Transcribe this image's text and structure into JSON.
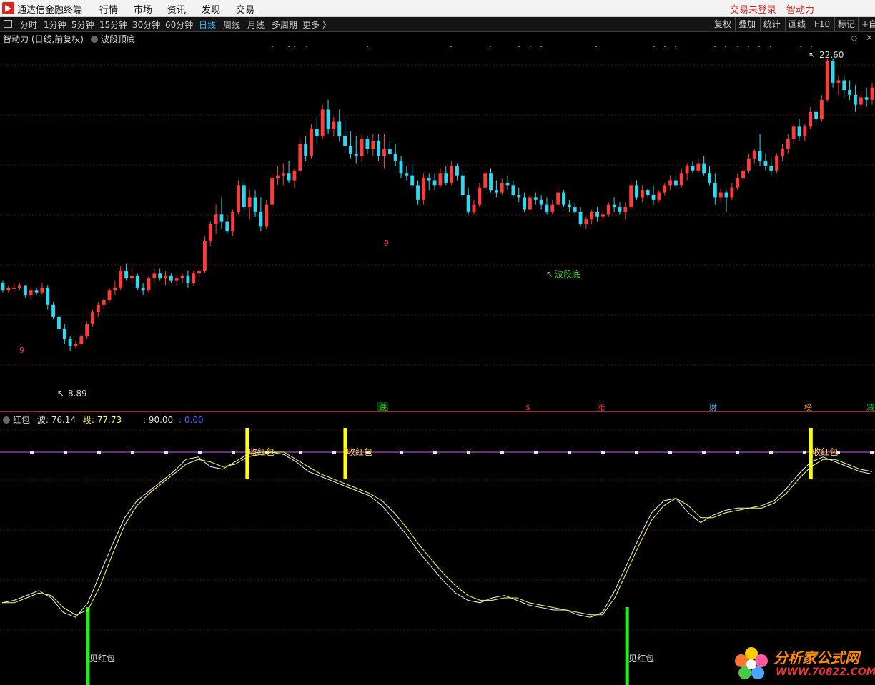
{
  "app": {
    "title": "通达信金融终端"
  },
  "menu": {
    "items": [
      "行情",
      "市场",
      "资讯",
      "发现",
      "交易"
    ],
    "login": "交易未登录",
    "brand": "智动力"
  },
  "toolbar": {
    "periods": [
      "分时",
      "1分钟",
      "5分钟",
      "15分钟",
      "30分钟",
      "60分钟",
      "日线",
      "周线",
      "月线",
      "多周期",
      "更多 〉"
    ],
    "active": "日线",
    "right": [
      "复权",
      "叠加",
      "统计",
      "画线",
      "F10",
      "标记",
      "+自"
    ]
  },
  "main_panel": {
    "title": "智动力 (日线,前复权)",
    "indicator": "波段顶底",
    "high_label": "22.60",
    "low_label": "8.89",
    "bottom_mark": "波段底",
    "count_marks": [
      "9",
      "9"
    ],
    "signal_marks": [
      {
        "label": "跌",
        "color": "#22c522"
      },
      {
        "label": "$",
        "color": "#e33"
      },
      {
        "label": "涨",
        "color": "#e33"
      },
      {
        "label": "财",
        "color": "#2fb7ff"
      },
      {
        "label": "榜",
        "color": "#ff9c00"
      },
      {
        "label": "减",
        "color": "#22c522"
      }
    ]
  },
  "sub_panel": {
    "name": "红包",
    "wave_label": "波:",
    "wave_value": "76.14",
    "seg_label": "段:",
    "seg_value": "77.73",
    "level_label": ": 90.00",
    "extra_value": ": 0.00",
    "sell_label": "收红包",
    "buy_label": "见红包"
  },
  "watermark": {
    "title": "分析家公式网",
    "url": "WWW.70822.COM"
  },
  "chart_data": {
    "type": "candlestick",
    "series_up_color": "#ff3b3b",
    "series_down_color": "#2fd8f2",
    "price_high": 22.6,
    "price_low": 8.89,
    "candles": [
      [
        13.4,
        13.5,
        13.0,
        13.1
      ],
      [
        13.1,
        13.3,
        13.0,
        13.2
      ],
      [
        13.2,
        13.4,
        13.0,
        13.2
      ],
      [
        13.2,
        13.4,
        13.1,
        13.3
      ],
      [
        13.3,
        13.3,
        12.8,
        12.9
      ],
      [
        12.9,
        13.2,
        12.7,
        13.1
      ],
      [
        13.1,
        13.2,
        12.9,
        13.0
      ],
      [
        13.0,
        13.4,
        12.9,
        13.2
      ],
      [
        13.2,
        13.3,
        12.3,
        12.5
      ],
      [
        12.5,
        12.6,
        11.9,
        12.0
      ],
      [
        12.0,
        12.1,
        11.3,
        11.5
      ],
      [
        11.5,
        11.7,
        10.9,
        11.1
      ],
      [
        11.1,
        11.2,
        10.6,
        10.8
      ],
      [
        10.8,
        11.0,
        10.7,
        10.9
      ],
      [
        10.9,
        11.3,
        10.8,
        11.2
      ],
      [
        11.2,
        11.8,
        11.1,
        11.7
      ],
      [
        11.7,
        12.3,
        11.6,
        12.2
      ],
      [
        12.2,
        12.6,
        12.0,
        12.5
      ],
      [
        12.5,
        12.8,
        12.3,
        12.7
      ],
      [
        12.7,
        13.2,
        12.6,
        13.1
      ],
      [
        13.1,
        13.5,
        12.9,
        13.2
      ],
      [
        13.2,
        14.1,
        13.1,
        13.9
      ],
      [
        13.9,
        14.2,
        13.5,
        13.6
      ],
      [
        13.6,
        14.0,
        13.4,
        13.7
      ],
      [
        13.7,
        13.8,
        13.1,
        13.2
      ],
      [
        13.2,
        13.4,
        12.9,
        13.1
      ],
      [
        13.1,
        13.7,
        13.0,
        13.6
      ],
      [
        13.6,
        14.0,
        13.4,
        13.8
      ],
      [
        13.8,
        14.0,
        13.5,
        13.6
      ],
      [
        13.6,
        13.9,
        13.3,
        13.7
      ],
      [
        13.7,
        13.8,
        13.4,
        13.5
      ],
      [
        13.5,
        13.7,
        13.3,
        13.6
      ],
      [
        13.6,
        13.8,
        13.4,
        13.7
      ],
      [
        13.7,
        13.9,
        13.2,
        13.4
      ],
      [
        13.4,
        13.9,
        13.3,
        13.8
      ],
      [
        13.8,
        14.0,
        13.6,
        13.9
      ],
      [
        13.9,
        15.3,
        13.8,
        15.1
      ],
      [
        15.1,
        15.9,
        14.9,
        15.8
      ],
      [
        15.8,
        16.6,
        15.4,
        16.2
      ],
      [
        16.2,
        16.9,
        15.6,
        15.9
      ],
      [
        15.9,
        16.2,
        15.4,
        15.5
      ],
      [
        15.5,
        16.4,
        15.3,
        16.3
      ],
      [
        16.3,
        17.6,
        16.2,
        17.4
      ],
      [
        17.4,
        17.6,
        16.3,
        16.5
      ],
      [
        16.5,
        17.2,
        16.0,
        16.9
      ],
      [
        16.9,
        17.2,
        16.1,
        16.3
      ],
      [
        16.3,
        16.9,
        15.5,
        15.7
      ],
      [
        15.7,
        16.8,
        15.6,
        16.6
      ],
      [
        16.6,
        17.9,
        16.5,
        17.7
      ],
      [
        17.7,
        18.2,
        17.4,
        17.8
      ],
      [
        17.8,
        18.3,
        17.4,
        17.9
      ],
      [
        17.9,
        18.4,
        17.5,
        17.6
      ],
      [
        17.6,
        18.1,
        17.3,
        18.0
      ],
      [
        18.0,
        19.3,
        17.9,
        19.1
      ],
      [
        19.1,
        19.4,
        18.4,
        18.6
      ],
      [
        18.6,
        19.9,
        18.5,
        19.7
      ],
      [
        19.7,
        20.2,
        19.1,
        19.4
      ],
      [
        19.4,
        20.7,
        19.3,
        20.5
      ],
      [
        20.5,
        20.9,
        19.5,
        19.7
      ],
      [
        19.7,
        20.2,
        19.4,
        20.0
      ],
      [
        20.0,
        20.5,
        19.2,
        19.4
      ],
      [
        19.4,
        20.1,
        18.8,
        19.0
      ],
      [
        19.0,
        19.6,
        18.5,
        18.7
      ],
      [
        18.7,
        19.4,
        18.3,
        18.6
      ],
      [
        18.6,
        19.5,
        18.4,
        19.3
      ],
      [
        19.3,
        19.4,
        18.7,
        18.9
      ],
      [
        18.9,
        19.5,
        18.6,
        19.2
      ],
      [
        19.2,
        19.5,
        18.4,
        18.6
      ],
      [
        18.6,
        19.5,
        18.1,
        18.9
      ],
      [
        18.9,
        19.2,
        18.6,
        18.7
      ],
      [
        18.7,
        19.1,
        18.2,
        18.4
      ],
      [
        18.4,
        18.6,
        17.7,
        17.9
      ],
      [
        17.9,
        18.2,
        17.6,
        17.8
      ],
      [
        17.8,
        18.3,
        17.3,
        17.4
      ],
      [
        17.4,
        17.6,
        16.6,
        16.8
      ],
      [
        16.8,
        17.9,
        16.6,
        17.7
      ],
      [
        17.7,
        17.9,
        17.2,
        17.6
      ],
      [
        17.6,
        17.9,
        17.2,
        17.4
      ],
      [
        17.4,
        18.1,
        17.3,
        17.9
      ],
      [
        17.9,
        18.2,
        17.4,
        17.5
      ],
      [
        17.5,
        18.4,
        17.4,
        18.2
      ],
      [
        18.2,
        18.3,
        17.6,
        17.8
      ],
      [
        17.8,
        18.0,
        16.9,
        17.0
      ],
      [
        17.0,
        17.3,
        16.2,
        16.3
      ],
      [
        16.3,
        16.8,
        16.2,
        16.6
      ],
      [
        16.6,
        17.5,
        16.5,
        17.3
      ],
      [
        17.3,
        18.0,
        17.2,
        17.9
      ],
      [
        17.9,
        18.1,
        17.1,
        17.2
      ],
      [
        17.2,
        17.6,
        16.9,
        17.1
      ],
      [
        17.1,
        17.7,
        17.0,
        17.5
      ],
      [
        17.5,
        17.8,
        17.2,
        17.4
      ],
      [
        17.4,
        17.6,
        16.9,
        17.0
      ],
      [
        17.0,
        17.3,
        16.7,
        16.9
      ],
      [
        16.9,
        17.1,
        16.3,
        16.4
      ],
      [
        16.4,
        17.0,
        16.3,
        16.9
      ],
      [
        16.9,
        17.1,
        16.6,
        16.8
      ],
      [
        16.8,
        17.0,
        16.4,
        16.6
      ],
      [
        16.6,
        16.9,
        16.2,
        16.3
      ],
      [
        16.3,
        16.8,
        16.2,
        16.6
      ],
      [
        16.6,
        17.3,
        16.5,
        17.1
      ],
      [
        17.1,
        17.2,
        16.5,
        16.6
      ],
      [
        16.6,
        16.8,
        16.3,
        16.5
      ],
      [
        16.5,
        16.7,
        16.2,
        16.3
      ],
      [
        16.3,
        16.5,
        15.7,
        15.8
      ],
      [
        15.8,
        16.1,
        15.6,
        16.0
      ],
      [
        16.0,
        16.4,
        15.8,
        16.3
      ],
      [
        16.3,
        16.5,
        15.9,
        16.1
      ],
      [
        16.1,
        16.4,
        15.9,
        16.2
      ],
      [
        16.2,
        16.7,
        16.1,
        16.6
      ],
      [
        16.6,
        16.9,
        16.3,
        16.5
      ],
      [
        16.5,
        16.7,
        16.2,
        16.3
      ],
      [
        16.3,
        16.7,
        16.0,
        16.5
      ],
      [
        16.5,
        17.6,
        16.4,
        17.4
      ],
      [
        17.4,
        17.6,
        16.8,
        16.9
      ],
      [
        16.9,
        17.4,
        16.7,
        17.2
      ],
      [
        17.2,
        17.3,
        16.9,
        17.0
      ],
      [
        17.0,
        17.4,
        16.6,
        16.8
      ],
      [
        16.8,
        17.2,
        16.7,
        17.1
      ],
      [
        17.1,
        17.5,
        17.0,
        17.4
      ],
      [
        17.4,
        17.8,
        17.2,
        17.6
      ],
      [
        17.6,
        17.8,
        17.3,
        17.4
      ],
      [
        17.4,
        18.1,
        17.3,
        17.9
      ],
      [
        17.9,
        18.3,
        17.6,
        18.2
      ],
      [
        18.2,
        18.4,
        17.9,
        18.0
      ],
      [
        18.0,
        18.5,
        17.9,
        18.3
      ],
      [
        18.3,
        18.6,
        17.8,
        17.9
      ],
      [
        17.9,
        18.2,
        17.4,
        17.5
      ],
      [
        17.5,
        17.9,
        16.6,
        16.9
      ],
      [
        16.9,
        17.3,
        16.7,
        17.1
      ],
      [
        17.1,
        17.2,
        16.3,
        16.9
      ],
      [
        16.9,
        17.5,
        16.8,
        17.3
      ],
      [
        17.3,
        17.9,
        17.2,
        17.7
      ],
      [
        17.7,
        18.2,
        17.6,
        18.0
      ],
      [
        18.0,
        18.7,
        17.9,
        18.5
      ],
      [
        18.5,
        18.9,
        18.3,
        18.8
      ],
      [
        18.8,
        19.5,
        18.2,
        18.4
      ],
      [
        18.4,
        18.7,
        18.0,
        18.2
      ],
      [
        18.2,
        18.5,
        17.8,
        18.0
      ],
      [
        18.0,
        18.7,
        17.9,
        18.6
      ],
      [
        18.6,
        19.1,
        18.4,
        18.9
      ],
      [
        18.9,
        19.5,
        18.7,
        19.3
      ],
      [
        19.3,
        19.9,
        19.1,
        19.8
      ],
      [
        19.8,
        20.1,
        19.2,
        19.4
      ],
      [
        19.4,
        19.9,
        19.2,
        19.8
      ],
      [
        19.8,
        20.6,
        19.7,
        20.4
      ],
      [
        20.4,
        20.8,
        19.9,
        20.1
      ],
      [
        20.1,
        21.1,
        20.0,
        20.9
      ],
      [
        20.9,
        22.6,
        20.8,
        22.5
      ],
      [
        22.5,
        22.6,
        21.4,
        21.6
      ],
      [
        21.6,
        21.9,
        21.1,
        21.7
      ],
      [
        21.7,
        21.9,
        21.0,
        21.3
      ],
      [
        21.3,
        21.7,
        20.9,
        21.1
      ],
      [
        21.1,
        21.5,
        20.4,
        20.7
      ],
      [
        20.7,
        21.2,
        20.5,
        21.0
      ],
      [
        21.0,
        21.4,
        20.6,
        20.9
      ],
      [
        20.9,
        21.6,
        20.7,
        21.4
      ]
    ],
    "wave_line": [
      28,
      29,
      31,
      33,
      30,
      24,
      22,
      28,
      40,
      52,
      63,
      70,
      74,
      78,
      82,
      87,
      88,
      84,
      83,
      86,
      89,
      90,
      90,
      89,
      86,
      82,
      80,
      78,
      76,
      74,
      72,
      68,
      62,
      56,
      49,
      43,
      37,
      32,
      29,
      28,
      30,
      31,
      29,
      27,
      26,
      25,
      25,
      23,
      22,
      24,
      33,
      44,
      55,
      65,
      70,
      71,
      65,
      61,
      64,
      66,
      67,
      67,
      68,
      70,
      75,
      81,
      86,
      88,
      86,
      84,
      82,
      81
    ],
    "seg_line": [
      28,
      28,
      30,
      32,
      31,
      26,
      23,
      25,
      35,
      48,
      60,
      68,
      73,
      77,
      81,
      85,
      87,
      86,
      84,
      85,
      88,
      89,
      90,
      90,
      87,
      84,
      81,
      79,
      77,
      75,
      73,
      70,
      65,
      59,
      52,
      46,
      40,
      35,
      31,
      29,
      29,
      30,
      30,
      28,
      27,
      26,
      25,
      24,
      23,
      23,
      30,
      41,
      52,
      62,
      68,
      71,
      68,
      63,
      63,
      65,
      66,
      67,
      67,
      69,
      73,
      79,
      84,
      87,
      87,
      85,
      83,
      82
    ],
    "level": 90,
    "signals": [
      {
        "type": "sell",
        "label": "收红包",
        "index": 20
      },
      {
        "type": "sell",
        "label": "收红包",
        "index": 28
      },
      {
        "type": "buy",
        "label": "见红包",
        "index": 7
      },
      {
        "type": "buy",
        "label": "见红包",
        "index": 51
      },
      {
        "type": "sell",
        "label": "收红包",
        "index": 66
      }
    ]
  }
}
